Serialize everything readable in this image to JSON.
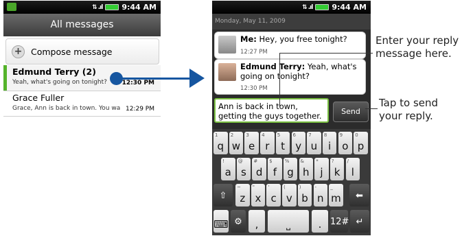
{
  "left_screen": {
    "status_time": "9:44 AM",
    "title": "All messages",
    "compose_label": "Compose message",
    "threads": [
      {
        "name": "Edmund Terry (2)",
        "snippet": "Yeah, what's going on tonight?",
        "time": "12:30 PM"
      },
      {
        "name": "Grace Fuller",
        "snippet": "Grace, Ann is back in town. You wan",
        "time": "12:29 PM"
      }
    ]
  },
  "right_screen": {
    "status_time": "9:44 AM",
    "date": "Monday, May 11, 2009",
    "messages": [
      {
        "sender": "Me:",
        "text": " Hey, you free tonight?",
        "time": "12:27 PM"
      },
      {
        "sender": "Edmund Terry:",
        "text": " Yeah, what's going on tonight?",
        "time": "12:30 PM"
      }
    ],
    "input_text": "Ann is back in town, getting the guys together.",
    "send_label": "Send"
  },
  "keyboard": {
    "row1": [
      {
        "alt": "1",
        "key": "q"
      },
      {
        "alt": "2",
        "key": "w"
      },
      {
        "alt": "3",
        "key": "e"
      },
      {
        "alt": "4",
        "key": "r"
      },
      {
        "alt": "5",
        "key": "t"
      },
      {
        "alt": "6",
        "key": "y"
      },
      {
        "alt": "7",
        "key": "u"
      },
      {
        "alt": "8",
        "key": "i"
      },
      {
        "alt": "9",
        "key": "o"
      },
      {
        "alt": "0",
        "key": "p"
      }
    ],
    "row2": [
      {
        "alt": "!",
        "key": "a"
      },
      {
        "alt": "@",
        "key": "s"
      },
      {
        "alt": "#",
        "key": "d"
      },
      {
        "alt": "$",
        "key": "f"
      },
      {
        "alt": "%",
        "key": "g"
      },
      {
        "alt": "&",
        "key": "h"
      },
      {
        "alt": "*",
        "key": "j"
      },
      {
        "alt": "?",
        "key": "k"
      },
      {
        "alt": "/",
        "key": "l"
      }
    ],
    "row3": [
      {
        "alt": "~",
        "key": "z"
      },
      {
        "alt": "\"",
        "key": "x"
      },
      {
        "alt": "'",
        "key": "c"
      },
      {
        "alt": "(",
        "key": "v"
      },
      {
        "alt": ")",
        "key": "b"
      },
      {
        "alt": "-",
        "key": "n"
      },
      {
        "alt": "_",
        "key": "m"
      }
    ],
    "shift": "⇧",
    "backspace": "⬅",
    "ime_icon": "⌨",
    "settings_icon": "⚙",
    "comma": ",",
    "space": "⎵",
    "period": ".",
    "sym": "12#",
    "enter": "↵"
  },
  "annotations": {
    "enter_reply": "Enter your reply message here.",
    "tap_send": "Tap to send your reply."
  },
  "colors": {
    "arrow": "#1656a0",
    "accent_green": "#54b32a"
  }
}
